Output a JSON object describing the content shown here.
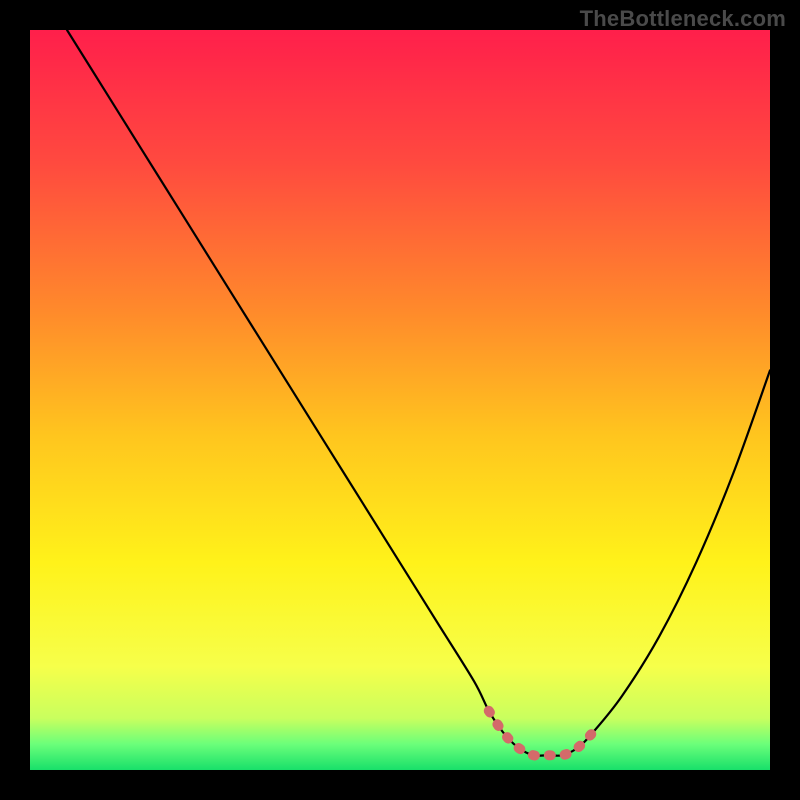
{
  "watermark": "TheBottleneck.com",
  "chart_data": {
    "type": "line",
    "title": "",
    "xlabel": "",
    "ylabel": "",
    "x_range": [
      0,
      100
    ],
    "y_range": [
      0,
      100
    ],
    "grid": false,
    "legend": false,
    "series": [
      {
        "name": "curve",
        "x": [
          5,
          10,
          15,
          20,
          25,
          30,
          35,
          40,
          45,
          50,
          55,
          60,
          62,
          64,
          66,
          68,
          70,
          72,
          74,
          76,
          80,
          85,
          90,
          95,
          100
        ],
        "y": [
          100,
          92,
          84,
          76,
          68,
          60,
          52,
          44,
          36,
          28,
          20,
          12,
          8,
          5,
          3,
          2,
          2,
          2,
          3,
          5,
          10,
          18,
          28,
          40,
          54
        ]
      }
    ],
    "highlight_band": {
      "x_start": 62,
      "x_end": 76,
      "color": "#d46a6a"
    },
    "gradient_stops": [
      {
        "offset": 0.0,
        "color": "#ff1f4b"
      },
      {
        "offset": 0.18,
        "color": "#ff4a3f"
      },
      {
        "offset": 0.38,
        "color": "#ff8a2b"
      },
      {
        "offset": 0.55,
        "color": "#ffc61e"
      },
      {
        "offset": 0.72,
        "color": "#fff21a"
      },
      {
        "offset": 0.86,
        "color": "#f6ff4a"
      },
      {
        "offset": 0.93,
        "color": "#c9ff5e"
      },
      {
        "offset": 0.965,
        "color": "#6bff7a"
      },
      {
        "offset": 1.0,
        "color": "#18e06a"
      }
    ]
  }
}
